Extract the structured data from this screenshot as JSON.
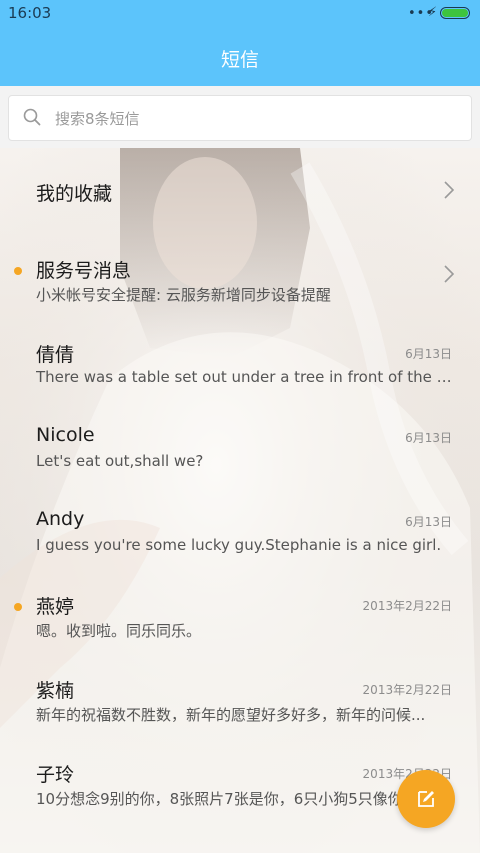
{
  "status_bar": {
    "time": "16:03",
    "dots": "•••",
    "bolt": "⚡"
  },
  "header": {
    "title": "短信"
  },
  "search": {
    "placeholder": "搜索8条短信"
  },
  "conversations": [
    {
      "name": "我的收藏",
      "snippet": "",
      "date": "",
      "unread": false,
      "chevron": true
    },
    {
      "name": "服务号消息",
      "snippet": "小米帐号安全提醒: 云服务新增同步设备提醒",
      "date": "",
      "unread": true,
      "chevron": true
    },
    {
      "name": "倩倩",
      "snippet": "There was a table set out under a tree in front of the ho...",
      "date": "6月13日",
      "unread": false,
      "chevron": false
    },
    {
      "name": "Nicole",
      "snippet": "Let's eat out,shall we?",
      "date": "6月13日",
      "unread": false,
      "chevron": false
    },
    {
      "name": "Andy",
      "snippet": "I guess you're some lucky guy.Stephanie is a nice girl.",
      "date": "6月13日",
      "unread": false,
      "chevron": false
    },
    {
      "name": "燕婷",
      "snippet": "嗯。收到啦。同乐同乐。",
      "date": "2013年2月22日",
      "unread": true,
      "chevron": false
    },
    {
      "name": "紫楠",
      "snippet": "新年的祝福数不胜数，新年的愿望好多好多，新年的问候...",
      "date": "2013年2月22日",
      "unread": false,
      "chevron": false
    },
    {
      "name": "子玲",
      "snippet": "10分想念9别的你，8张照片7张是你，6只小狗5只像你",
      "date": "2013年2月22日",
      "unread": false,
      "chevron": false
    }
  ],
  "colors": {
    "header": "#5cc4fb",
    "accent": "#f5a623",
    "battery": "#3ec43e"
  },
  "icons": {
    "search": "search-icon",
    "chevron": "chevron-right-icon",
    "compose": "compose-icon"
  }
}
